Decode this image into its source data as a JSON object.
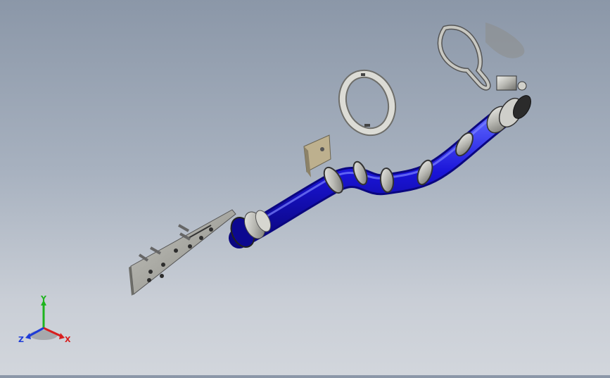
{
  "viewport": {
    "background_top": "#8b97a8",
    "background_bottom": "#d2d6dc",
    "model_colors": {
      "hose": "#1a14d8",
      "hose_highlight": "#5a62ff",
      "metal": "#c8c8c4",
      "metal_dark": "#6e6e6a",
      "plate": "#a9a9a4",
      "bracket": "#b8a98a"
    }
  },
  "triad": {
    "x_label": "X",
    "y_label": "Y",
    "z_label": "Z",
    "x_color": "#d81e1e",
    "y_color": "#1eb41e",
    "z_color": "#1e3cd8"
  }
}
